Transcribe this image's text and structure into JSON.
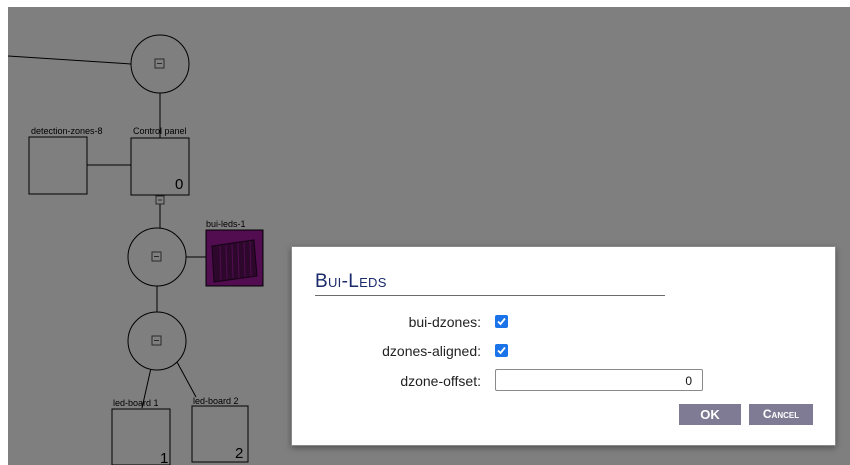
{
  "diagram": {
    "nodes": {
      "detection_zones": "detection-zones-8",
      "control_panel": "Control panel",
      "control_panel_value": "0",
      "bui_leds": "bui-leds-1",
      "led_board_1": "led-board 1",
      "led_board_1_value": "1",
      "led_board_2": "led-board 2",
      "led_board_2_value": "2"
    },
    "hub_icon": "minus-box-icon"
  },
  "dialog": {
    "title": "Bui-Leds",
    "fields": [
      {
        "label": "bui-dzones:",
        "type": "checkbox",
        "checked": true
      },
      {
        "label": "dzones-aligned:",
        "type": "checkbox",
        "checked": true
      },
      {
        "label": "dzone-offset:",
        "type": "number",
        "value": "0"
      }
    ],
    "ok_label": "OK",
    "cancel_label": "Cancel"
  },
  "colors": {
    "accent": "#1a73e8",
    "button": "#7f7b94",
    "title": "#1b2a6b",
    "highlight": "#a21aa0"
  }
}
